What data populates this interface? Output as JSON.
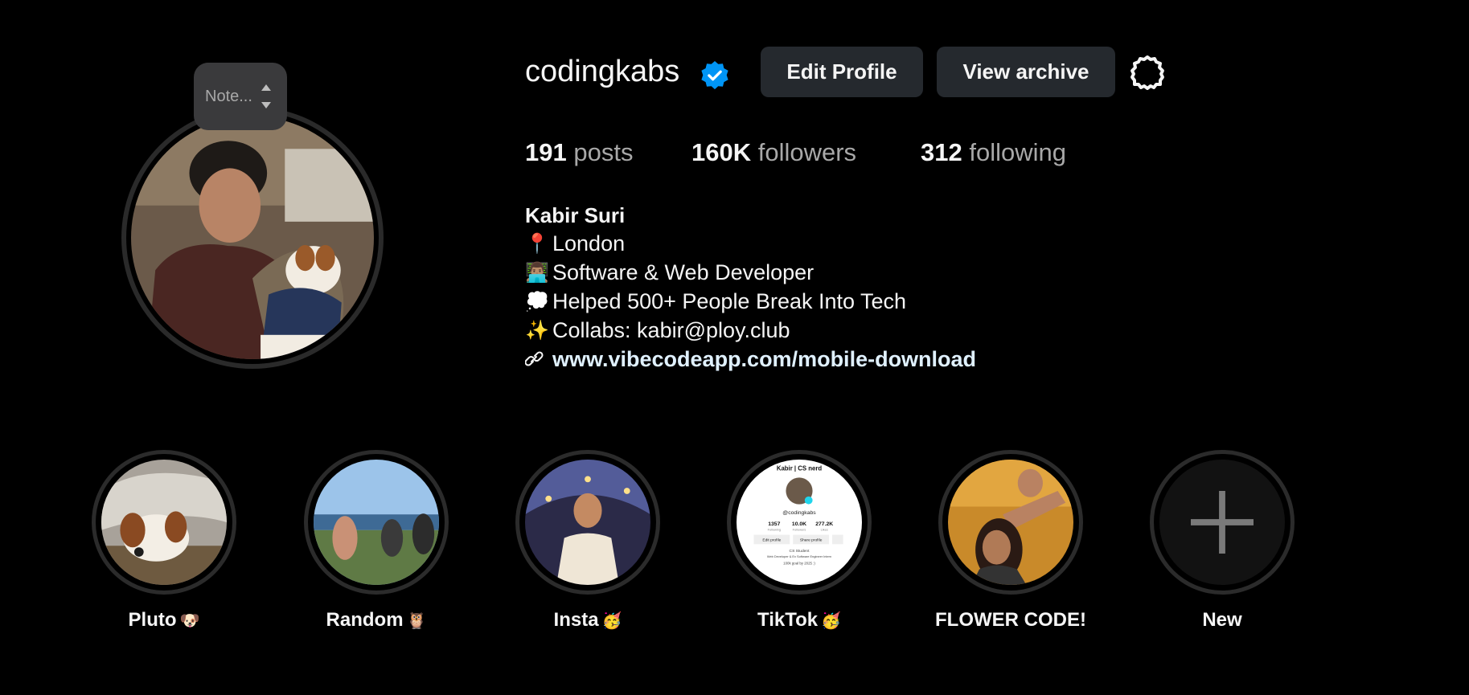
{
  "note": {
    "placeholder": "Note..."
  },
  "profile": {
    "username": "codingkabs",
    "verified_color": "#0095f6"
  },
  "actions": {
    "edit_profile": "Edit Profile",
    "view_archive": "View archive"
  },
  "stats": {
    "posts": {
      "count": "191",
      "label": "posts"
    },
    "followers": {
      "count": "160K",
      "label": "followers"
    },
    "following": {
      "count": "312",
      "label": "following"
    }
  },
  "bio": {
    "name": "Kabir Suri",
    "lines": [
      {
        "emoji": "📍",
        "text": "London"
      },
      {
        "emoji": "👨🏽‍💻",
        "text": "Software & Web Developer"
      },
      {
        "emoji": "💭",
        "text": "Helped 500+ People Break Into Tech"
      },
      {
        "emoji": "✨",
        "text": "Collabs: kabir@ploy.club"
      }
    ],
    "link": "www.vibecodeapp.com/mobile-download"
  },
  "highlights": [
    {
      "title": "Pluto",
      "emoji": "🐶"
    },
    {
      "title": "Random",
      "emoji": "🦉"
    },
    {
      "title": "Insta",
      "emoji": "🥳"
    },
    {
      "title": "TikTok",
      "emoji": "🥳"
    },
    {
      "title": "FLOWER CODE!",
      "emoji": ""
    },
    {
      "title": "New",
      "emoji": ""
    }
  ],
  "tiktok_card": {
    "name": "Kabir | CS nerd",
    "handle": "@codingkabs",
    "following": "1357",
    "followers": "10.0K",
    "likes": "277.2K",
    "following_label": "Following",
    "followers_label": "Followers",
    "likes_label": "Likes",
    "edit": "Edit profile",
    "share": "Share profile",
    "bio1": "CS Student",
    "bio2": "Web Developer & Ex Software Engineer Intern",
    "bio3": "100k goal by 2025 :)"
  }
}
